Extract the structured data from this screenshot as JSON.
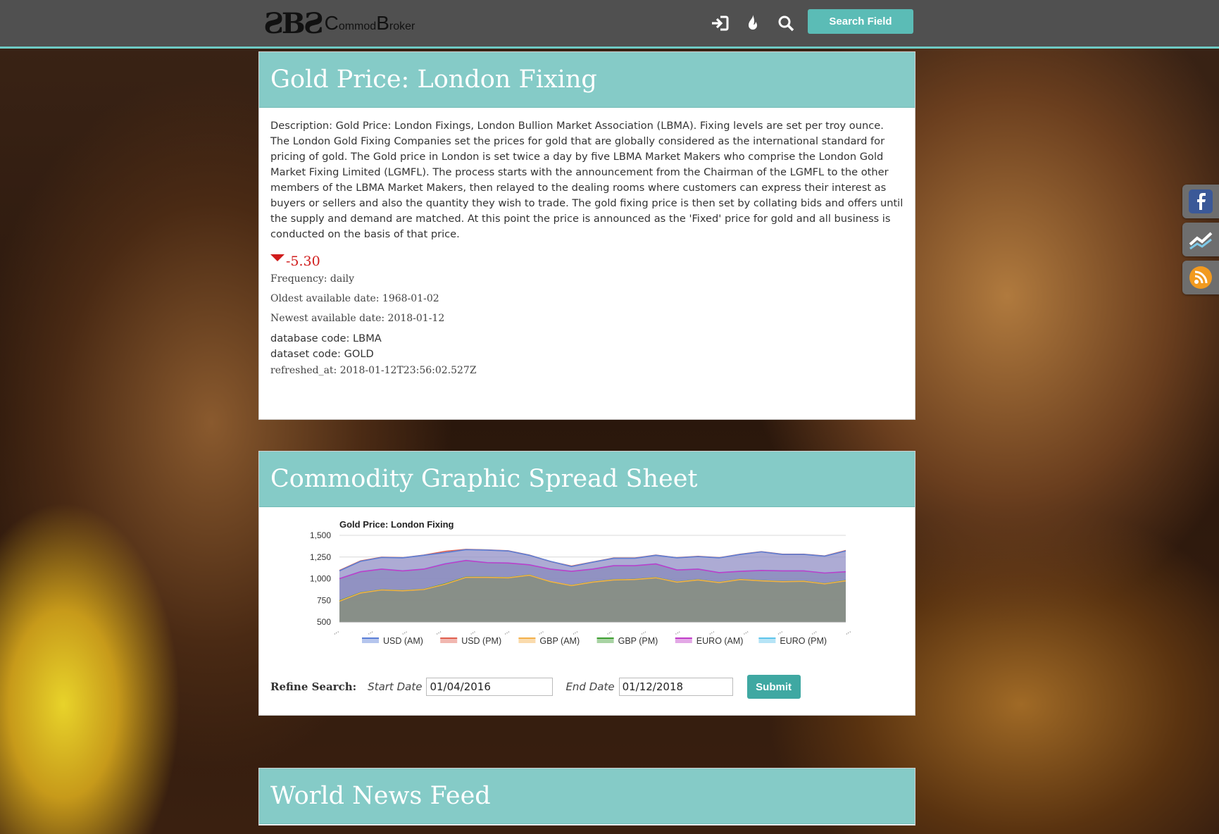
{
  "nav": {
    "logo_mark": "ƧBƧ",
    "logo_c": "C",
    "logo_part1": "ommod",
    "logo_b": "B",
    "logo_part2": "roker",
    "search_button": "Search Field",
    "icons": [
      "sign-in-icon",
      "fire-icon",
      "search-icon"
    ]
  },
  "dataset": {
    "title": "Gold Price: London Fixing",
    "description": "Description: Gold Price: London Fixings, London Bullion Market Association (LBMA). Fixing levels are set per troy ounce. The London Gold Fixing Companies set the prices for gold that are globally considered as the international standard for pricing of gold. The Gold price in London is set twice a day by five LBMA Market Makers who comprise the London Gold Market Fixing Limited (LGMFL). The process starts with the announcement from the Chairman of the LGMFL to the other members of the LBMA Market Makers, then relayed to the dealing rooms where customers can express their interest as buyers or sellers and also the quantity they wish to trade. The gold fixing price is then set by collating bids and offers until the supply and demand are matched. At this point the price is announced as the 'Fixed' price for gold and all business is conducted on the basis of that price.",
    "change": "-5.30",
    "change_color": "#d01c1c",
    "frequency": "Frequency: daily",
    "oldest": "Oldest available date: 1968-01-02",
    "newest": "Newest available date: 2018-01-12",
    "database_code": "database code: LBMA",
    "dataset_code": "dataset code: GOLD",
    "refreshed_at": "refreshed_at: 2018-01-12T23:56:02.527Z"
  },
  "spreadsheet": {
    "title": "Commodity Graphic Spread Sheet",
    "refine_label": "Refine Search:",
    "start_label": "Start Date",
    "start_value": "01/04/2016",
    "end_label": "End Date",
    "end_value": "01/12/2018",
    "submit_label": "Submit"
  },
  "news": {
    "title": "World News Feed"
  },
  "social": [
    "facebook-icon",
    "stocktwits-icon",
    "rss-icon"
  ],
  "colors": {
    "accent": "#85cbc7",
    "nav_bg": "#505050",
    "button": "#5bbcb6"
  },
  "chart_data": {
    "type": "area",
    "title": "Gold Price: London Fixing",
    "xlabel": "",
    "ylabel": "",
    "ylim": [
      500,
      1500
    ],
    "yticks": [
      "1,500",
      "1,250",
      "1,000",
      "750",
      "500"
    ],
    "ytick_values": [
      1500,
      1250,
      1000,
      750,
      500
    ],
    "x": [
      "2016-01",
      "2016-02",
      "2016-03",
      "2016-04",
      "2016-05",
      "2016-06",
      "2016-07",
      "2016-08",
      "2016-09",
      "2016-10",
      "2016-11",
      "2016-12",
      "2017-01",
      "2017-02",
      "2017-03",
      "2017-04",
      "2017-05",
      "2017-06",
      "2017-07",
      "2017-08",
      "2017-09",
      "2017-10",
      "2017-11",
      "2017-12",
      "2018-01"
    ],
    "series": [
      {
        "name": "USD (AM)",
        "color": "#5b7fd6",
        "values": [
          1090,
          1200,
          1245,
          1240,
          1270,
          1300,
          1335,
          1330,
          1320,
          1270,
          1200,
          1140,
          1190,
          1235,
          1235,
          1270,
          1240,
          1255,
          1240,
          1280,
          1310,
          1280,
          1280,
          1260,
          1320
        ]
      },
      {
        "name": "USD (PM)",
        "color": "#e0604f",
        "values": [
          1095,
          1205,
          1248,
          1242,
          1272,
          1315,
          1338,
          1332,
          1322,
          1272,
          1198,
          1145,
          1192,
          1238,
          1238,
          1272,
          1242,
          1258,
          1242,
          1282,
          1312,
          1282,
          1282,
          1262,
          1325
        ]
      },
      {
        "name": "GBP (AM)",
        "color": "#f3b04a",
        "values": [
          740,
          835,
          870,
          860,
          875,
          935,
          1015,
          1015,
          1010,
          1040,
          965,
          920,
          960,
          985,
          990,
          1010,
          960,
          985,
          955,
          990,
          975,
          965,
          970,
          940,
          975
        ]
      },
      {
        "name": "GBP (PM)",
        "color": "#3f9e32",
        "values": [
          745,
          838,
          872,
          862,
          877,
          940,
          1018,
          1017,
          1012,
          1042,
          963,
          922,
          962,
          987,
          992,
          1012,
          962,
          987,
          957,
          992,
          977,
          967,
          972,
          942,
          978
        ]
      },
      {
        "name": "EURO (AM)",
        "color": "#c03ec8",
        "values": [
          1000,
          1080,
          1110,
          1090,
          1110,
          1170,
          1210,
          1185,
          1180,
          1160,
          1110,
          1085,
          1110,
          1150,
          1150,
          1170,
          1100,
          1110,
          1070,
          1085,
          1095,
          1090,
          1090,
          1065,
          1080
        ]
      },
      {
        "name": "EURO (PM)",
        "color": "#5ec4ea",
        "values": [
          1002,
          1082,
          1112,
          1092,
          1112,
          1175,
          1212,
          1187,
          1182,
          1162,
          1112,
          1087,
          1112,
          1152,
          1152,
          1172,
          1102,
          1112,
          1072,
          1087,
          1097,
          1092,
          1092,
          1067,
          1082
        ]
      }
    ]
  }
}
